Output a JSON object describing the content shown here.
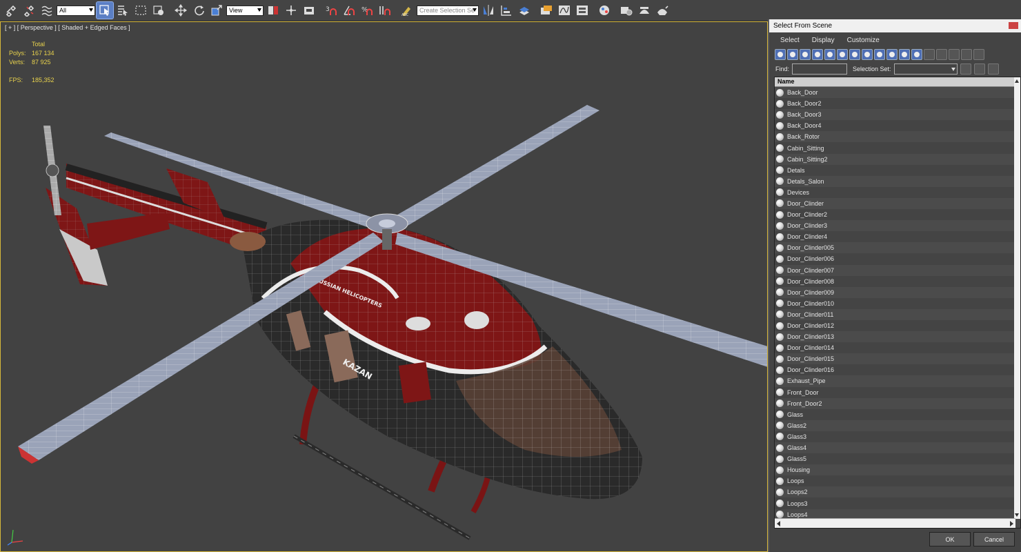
{
  "toolbar": {
    "filter_select": "All",
    "ref_coord_select": "View",
    "named_selection_placeholder": "Create Selection Se",
    "icons": [
      "link-icon",
      "unlink-icon",
      "bind-space-warp-icon",
      "select-object-icon",
      "select-by-name-icon",
      "rect-region-icon",
      "window-crossing-icon",
      "move-icon",
      "rotate-icon",
      "scale-icon",
      "pivot-icon",
      "select-manipulate-icon",
      "snap-3d-icon",
      "angle-snap-icon",
      "percent-snap-icon",
      "spinner-snap-icon",
      "edit-named-selection-icon",
      "mirror-icon",
      "align-icon",
      "layer-manager-icon",
      "scene-explorer-icon",
      "curve-editor-icon",
      "schematic-view-icon",
      "material-editor-icon",
      "render-setup-icon",
      "render-frame-icon",
      "render-icon"
    ]
  },
  "viewport": {
    "label": "[ + ] [ Perspective ] [ Shaded + Edged Faces ]",
    "stats": {
      "total_label": "Total",
      "polys_label": "Polys:",
      "polys_value": "167 134",
      "verts_label": "Verts:",
      "verts_value": "87 925",
      "fps_label": "FPS:",
      "fps_value": "185,352"
    },
    "model_text": "KAZAN",
    "model_text2": "RUSSIAN HELICOPTERS"
  },
  "dialog": {
    "title": "Select From Scene",
    "menu": [
      "Select",
      "Display",
      "Customize"
    ],
    "find_label": "Find:",
    "selection_set_label": "Selection Set:",
    "column_header": "Name",
    "items": [
      "Back_Door",
      "Back_Door2",
      "Back_Door3",
      "Back_Door4",
      "Back_Rotor",
      "Cabin_Sitting",
      "Cabin_Sitting2",
      "Detals",
      "Detals_Salon",
      "Devices",
      "Door_Clinder",
      "Door_Clinder2",
      "Door_Clinder3",
      "Door_Clinder4",
      "Door_Clinder005",
      "Door_Clinder006",
      "Door_Clinder007",
      "Door_Clinder008",
      "Door_Clinder009",
      "Door_Clinder010",
      "Door_Clinder011",
      "Door_Clinder012",
      "Door_Clinder013",
      "Door_Clinder014",
      "Door_Clinder015",
      "Door_Clinder016",
      "Exhaust_Pipe",
      "Front_Door",
      "Front_Door2",
      "Glass",
      "Glass2",
      "Glass3",
      "Glass4",
      "Glass5",
      "Housing",
      "Loops",
      "Loops2",
      "Loops3",
      "Loops4"
    ],
    "ok_label": "OK",
    "cancel_label": "Cancel"
  }
}
